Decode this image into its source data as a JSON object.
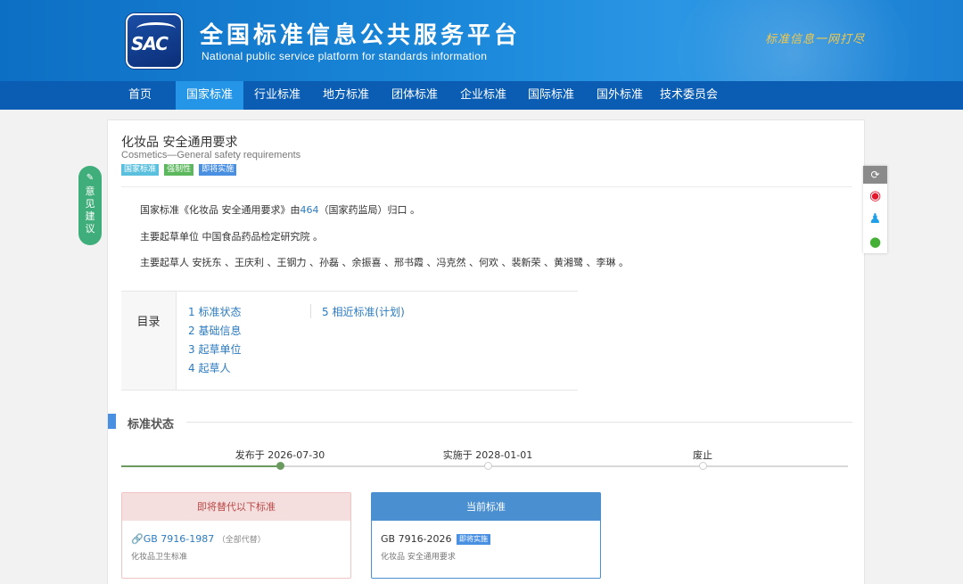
{
  "header": {
    "logo_text": "SAC",
    "title": "全国标准信息公共服务平台",
    "subtitle": "National public service platform  for standards information",
    "slogan": "标准信息一网打尽"
  },
  "nav": {
    "items": [
      "首页",
      "国家标准",
      "行业标准",
      "地方标准",
      "团体标准",
      "企业标准",
      "国际标准",
      "国外标准",
      "技术委员会"
    ],
    "active": "国家标准"
  },
  "standard": {
    "title": "化妆品 安全通用要求",
    "title_en": "Cosmetics—General safety requirements",
    "tags": [
      {
        "label": "国家标准",
        "color": "#5bc0de"
      },
      {
        "label": "强制性",
        "color": "#5cb85c"
      },
      {
        "label": "即将实施",
        "color": "#4a90e2"
      }
    ]
  },
  "info": {
    "line1_prefix": "国家标准《化妆品 安全通用要求》由",
    "line1_link": "464",
    "line1_suffix": "（国家药监局）归口 。",
    "line2": "主要起草单位 中国食品药品检定研究院 。",
    "line3": "主要起草人 安抚东 、王庆利 、王钢力 、孙磊 、余振喜 、邢书霞 、冯克然 、何欢 、裴新荣 、黄湘鹭 、李琳 。"
  },
  "toc": {
    "label": "目录",
    "items": [
      "1  标准状态",
      "2  基础信息",
      "3  起草单位",
      "4  起草人",
      "5  相近标准(计划)"
    ]
  },
  "status_section": {
    "title": "标准状态",
    "timeline": [
      "发布于 2026-07-30",
      "实施于 2028-01-01",
      "废止"
    ]
  },
  "cards": {
    "replace": {
      "header": "即将替代以下标准",
      "code": "GB 7916-1987",
      "note": "（全部代替）",
      "desc": "化妆品卫生标准",
      "colors": {
        "border": "#f0c4c4",
        "head_bg": "#f5dede",
        "head_text": "#b94a48"
      }
    },
    "current": {
      "header": "当前标准",
      "code": "GB 7916-2026",
      "badge": "即将实施",
      "desc": "化妆品 安全通用要求",
      "colors": {
        "border": "#4a8fd0",
        "head_bg": "#4a8fd0",
        "head_text": "#ffffff"
      }
    }
  },
  "feedback": {
    "chars": [
      "意",
      "见",
      "建",
      "议"
    ],
    "icon": "edit-icon"
  },
  "share": {
    "icons": [
      "refresh-icon",
      "weibo-icon",
      "qq-icon",
      "wechat-icon"
    ]
  }
}
